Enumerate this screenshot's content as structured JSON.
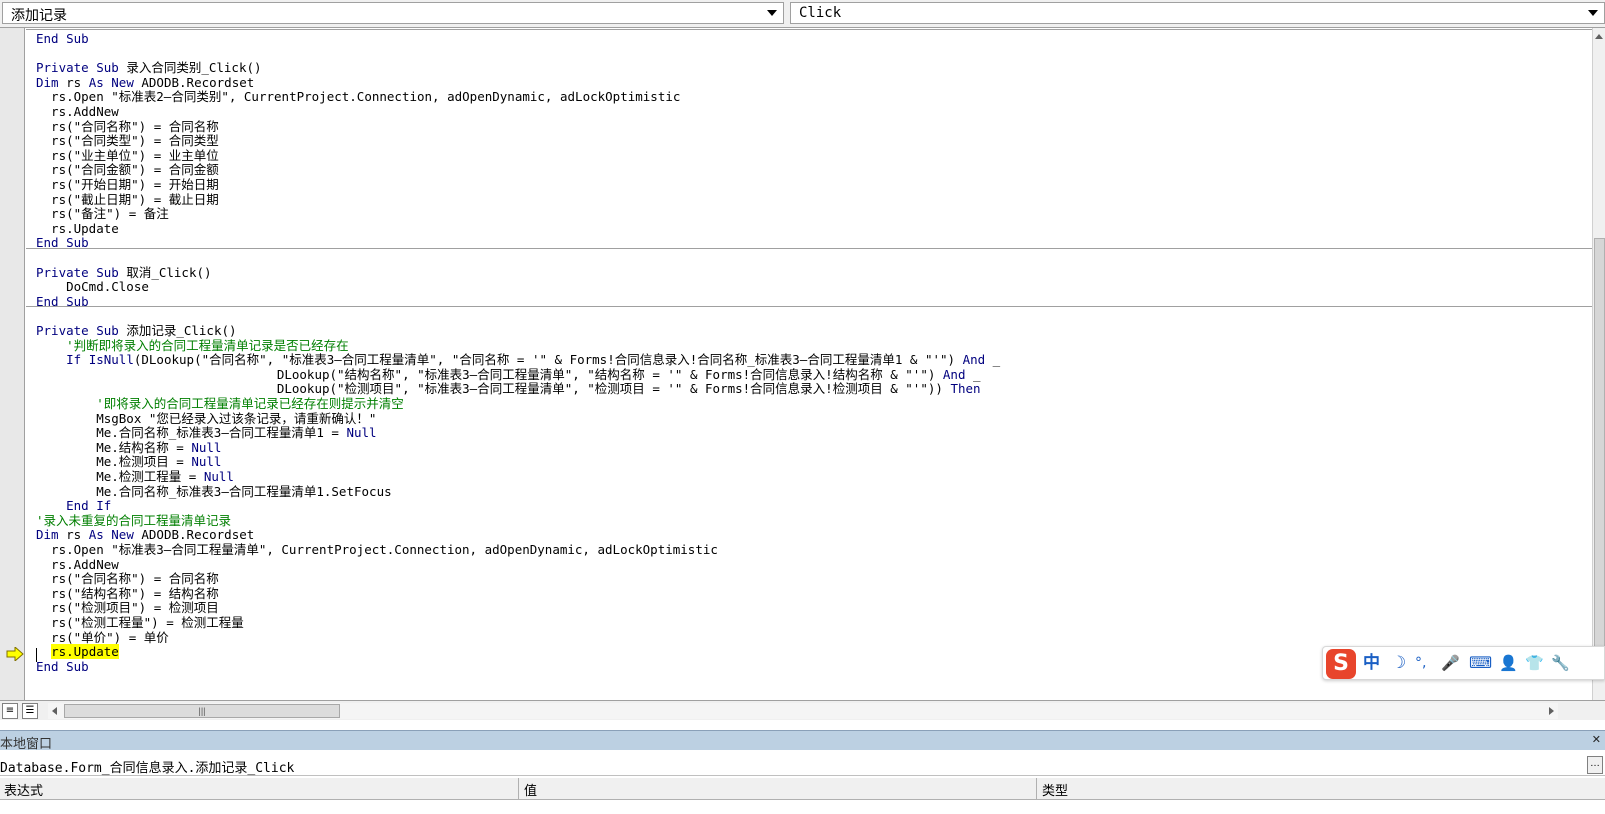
{
  "toolbar": {
    "object_combo": "添加记录",
    "procedure_combo": "Click"
  },
  "code_lines": [
    "End Sub",
    "",
    "Private Sub 录入合同类别_Click()",
    "Dim rs As New ADODB.Recordset",
    "  rs.Open \"标准表2—合同类别\", CurrentProject.Connection, adOpenDynamic, adLockOptimistic",
    "  rs.AddNew",
    "  rs(\"合同名称\") = 合同名称",
    "  rs(\"合同类型\") = 合同类型",
    "  rs(\"业主单位\") = 业主单位",
    "  rs(\"合同金额\") = 合同金额",
    "  rs(\"开始日期\") = 开始日期",
    "  rs(\"截止日期\") = 截止日期",
    "  rs(\"备注\") = 备注",
    "  rs.Update",
    "End Sub",
    "",
    "Private Sub 取消_Click()",
    "    DoCmd.Close",
    "End Sub",
    "",
    "Private Sub 添加记录_Click()",
    "    '判断即将录入的合同工程量清单记录是否已经存在",
    "    If IsNull(DLookup(\"合同名称\", \"标准表3—合同工程量清单\", \"合同名称 = '\" & Forms!合同信息录入!合同名称_标准表3—合同工程量清单1 & \"'\") And _",
    "                                DLookup(\"结构名称\", \"标准表3—合同工程量清单\", \"结构名称 = '\" & Forms!合同信息录入!结构名称 & \"'\") And _",
    "                                DLookup(\"检测项目\", \"标准表3—合同工程量清单\", \"检测项目 = '\" & Forms!合同信息录入!检测项目 & \"'\")) Then",
    "        '即将录入的合同工程量清单记录已经存在则提示并清空",
    "        MsgBox \"您已经录入过该条记录，请重新确认！\"",
    "        Me.合同名称_标准表3—合同工程量清单1 = Null",
    "        Me.结构名称 = Null",
    "        Me.检测项目 = Null",
    "        Me.检测工程量 = Null",
    "        Me.合同名称_标准表3—合同工程量清单1.SetFocus",
    "    End If",
    "'录入未重复的合同工程量清单记录",
    "Dim rs As New ADODB.Recordset",
    "  rs.Open \"标准表3—合同工程量清单\", CurrentProject.Connection, adOpenDynamic, adLockOptimistic",
    "  rs.AddNew",
    "  rs(\"合同名称\") = 合同名称",
    "  rs(\"结构名称\") = 结构名称",
    "  rs(\"检测项目\") = 检测项目",
    "  rs(\"检测工程量\") = 检测工程量",
    "  rs(\"单价\") = 单价",
    "  rs.Update",
    "End Sub"
  ],
  "current_line_index": 42,
  "locals": {
    "title": "本地窗口",
    "context": "Database.Form_合同信息录入.添加记录_Click",
    "columns": [
      "表达式",
      "值",
      "类型"
    ]
  },
  "ime": {
    "logo": "S",
    "mode": "中",
    "items": [
      "☽",
      "°,",
      "🎤",
      "⌨",
      "👤",
      "👕",
      "🔧"
    ]
  },
  "colors": {
    "keyword": "#00007f",
    "comment": "#007f00",
    "highlight": "#ffff00",
    "locals_title_bg": "#bcd0e2"
  }
}
